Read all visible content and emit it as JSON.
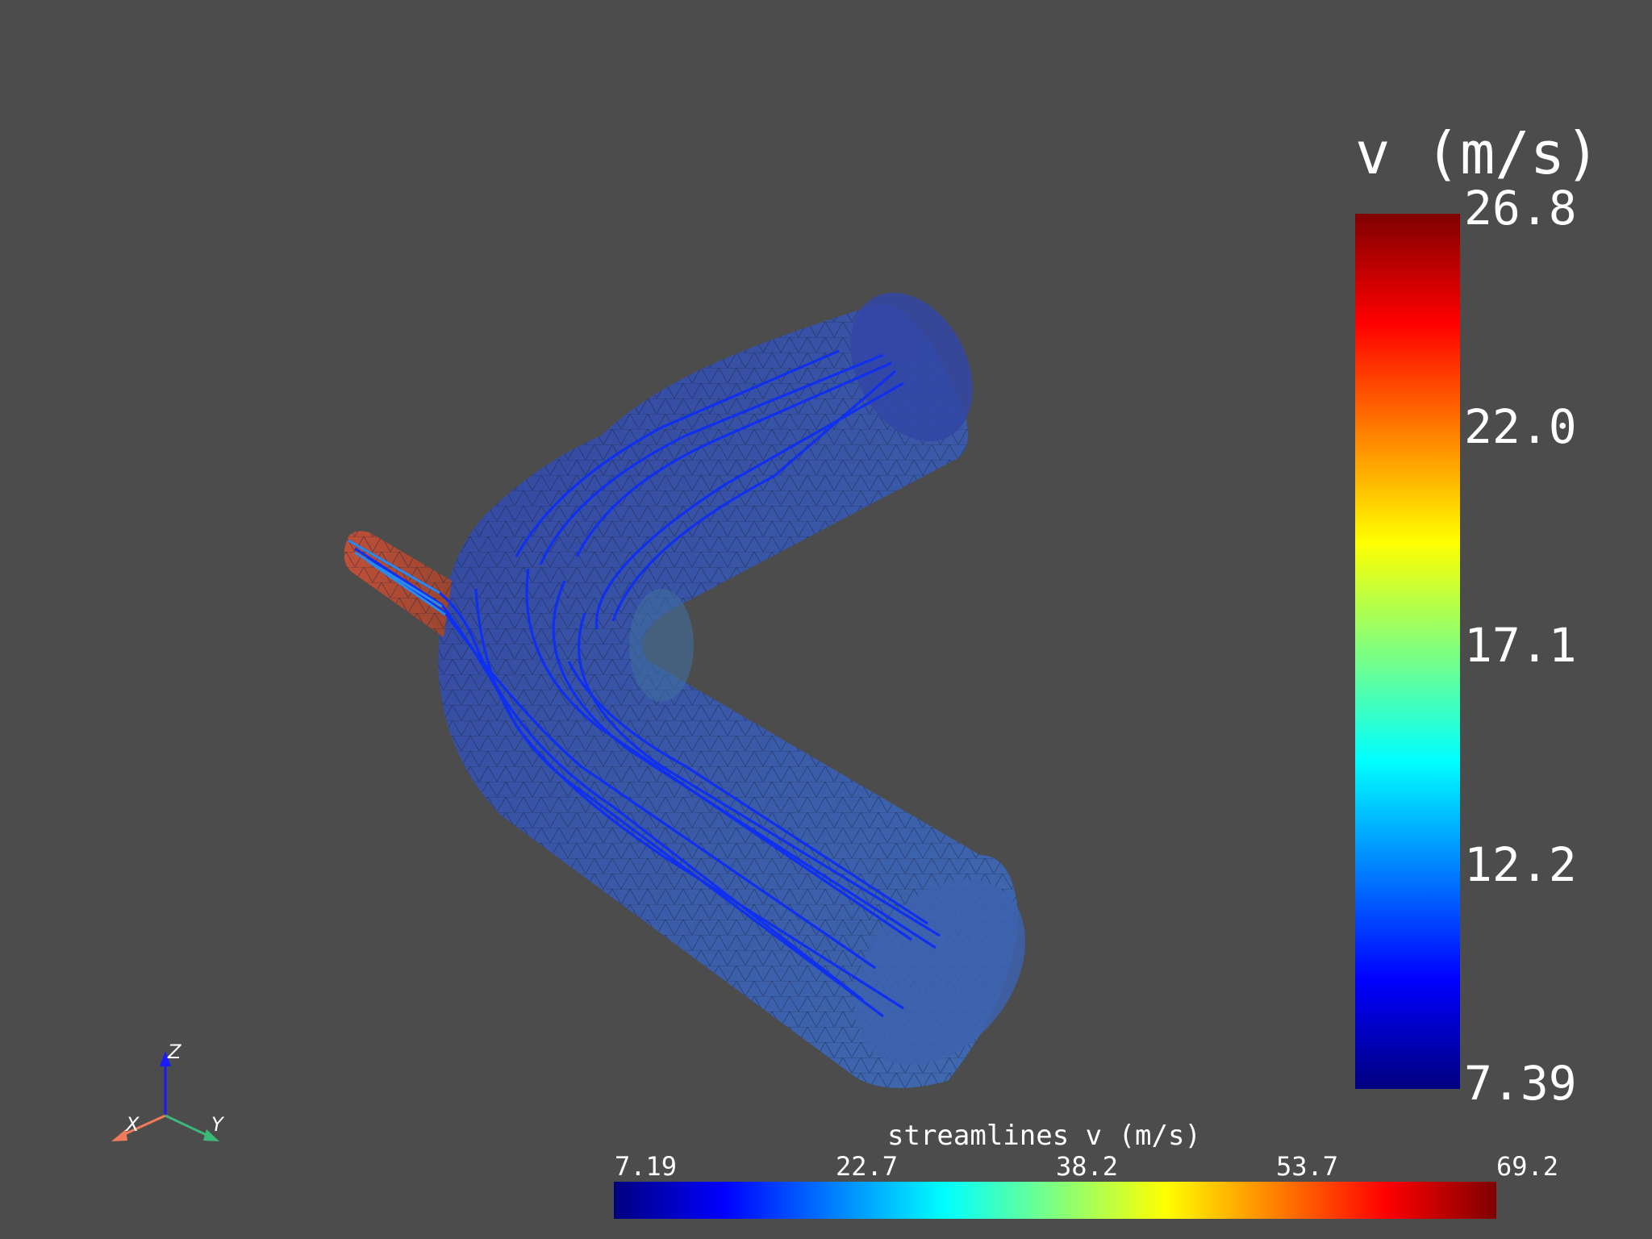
{
  "scalar_bar": {
    "title": "v (m/s)",
    "ticks": [
      "26.8",
      "22.0",
      "17.1",
      "12.2",
      "7.39"
    ],
    "range": [
      7.39,
      26.8
    ],
    "orientation": "vertical",
    "colormap": "jet"
  },
  "streamline_bar": {
    "title": "streamlines v (m/s)",
    "ticks": [
      "7.19",
      "22.7",
      "38.2",
      "53.7",
      "69.2"
    ],
    "range": [
      7.19,
      69.2
    ],
    "orientation": "horizontal",
    "colormap": "jet"
  },
  "axes": {
    "x_label": "X",
    "y_label": "Y",
    "z_label": "Z",
    "x_color": "#f07a5a",
    "y_color": "#3cb878",
    "z_color": "#1a1aff"
  },
  "colors": {
    "background": "#4c4c4c",
    "pipe_surface": "#3a4ea0",
    "inlet_surface": "#b04a35",
    "streamline": "#1030f0"
  }
}
